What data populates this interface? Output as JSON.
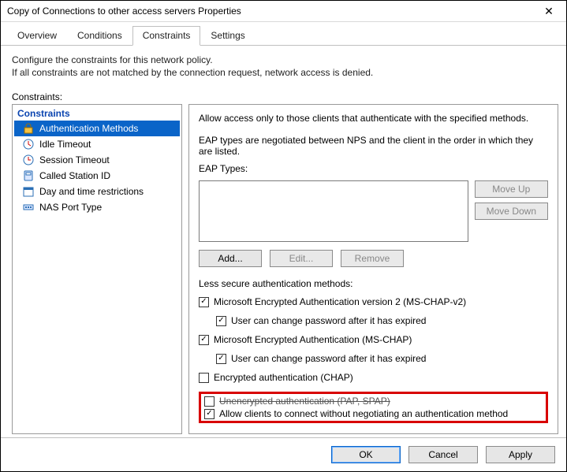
{
  "window": {
    "title": "Copy of Connections to other access servers Properties",
    "close": "✕"
  },
  "tabs": {
    "overview": "Overview",
    "conditions": "Conditions",
    "constraints": "Constraints",
    "settings": "Settings"
  },
  "description": {
    "line1": "Configure the constraints for this network policy.",
    "line2": "If all constraints are not matched by the connection request, network access is denied."
  },
  "tree": {
    "label": "Constraints:",
    "header": "Constraints",
    "items": [
      {
        "label": "Authentication Methods",
        "icon": "lock"
      },
      {
        "label": "Idle Timeout",
        "icon": "idle"
      },
      {
        "label": "Session Timeout",
        "icon": "session"
      },
      {
        "label": "Called Station ID",
        "icon": "phone"
      },
      {
        "label": "Day and time restrictions",
        "icon": "calendar"
      },
      {
        "label": "NAS Port Type",
        "icon": "port"
      }
    ]
  },
  "pane": {
    "intro": "Allow access only to those clients that authenticate with the specified methods.",
    "eap_note": "EAP types are negotiated between NPS and the client in the order in which they are listed.",
    "eap_label": "EAP Types:",
    "move_up": "Move Up",
    "move_down": "Move Down",
    "add": "Add...",
    "edit": "Edit...",
    "remove": "Remove",
    "less_secure": "Less secure authentication methods:",
    "chk_mschapv2": "Microsoft Encrypted Authentication version 2 (MS-CHAP-v2)",
    "chk_user_change1": "User can change password after it has expired",
    "chk_mschap": "Microsoft Encrypted Authentication (MS-CHAP)",
    "chk_user_change2": "User can change password after it has expired",
    "chk_chap": "Encrypted authentication (CHAP)",
    "chk_pap": "Unencrypted authentication (PAP, SPAP)",
    "chk_allow": "Allow clients to connect without negotiating an authentication method"
  },
  "buttons": {
    "ok": "OK",
    "cancel": "Cancel",
    "apply": "Apply"
  }
}
